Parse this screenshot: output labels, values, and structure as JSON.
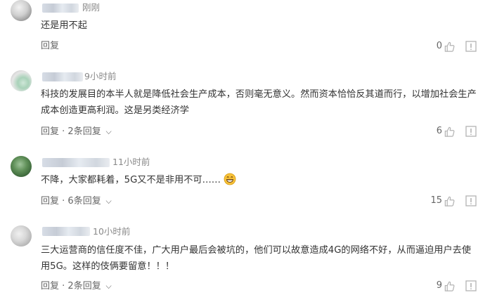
{
  "comments": [
    {
      "time": "刚刚",
      "text": "还是用不起",
      "reply_label": "回复",
      "reply_count": "",
      "likes": "0"
    },
    {
      "time": "9小时前",
      "text": "科技的发展目的本半人就是降低社会生产成本，否则毫无意义。然而资本恰恰反其道而行，以增加社会生产成本创造更高利润。这是另类经济学",
      "reply_label": "回复",
      "reply_count": "· 2条回复",
      "likes": "6"
    },
    {
      "time": "11小时前",
      "text": "不降，大家都耗着，5G又不是非用不可……",
      "reply_label": "回复",
      "reply_count": "· 6条回复",
      "likes": "15"
    },
    {
      "time": "10小时前",
      "text": "三大运营商的信任度不佳，广大用户最后会被坑的，他们可以故意造成4G的网络不好，从而逼迫用户去使用5G。这样的伎俩要留意！！！",
      "reply_label": "回复",
      "reply_count": "· 2条回复",
      "likes": "9"
    }
  ],
  "icons": {
    "like": "thumbs-up-icon",
    "report": "report-icon",
    "emoji": "grin-emoji-icon",
    "chevron": "chevron-down-icon"
  },
  "colors": {
    "text": "#333333",
    "meta": "#888888",
    "action": "#666666",
    "icon": "#b3b3b3",
    "emoji": "#f7c23a"
  }
}
